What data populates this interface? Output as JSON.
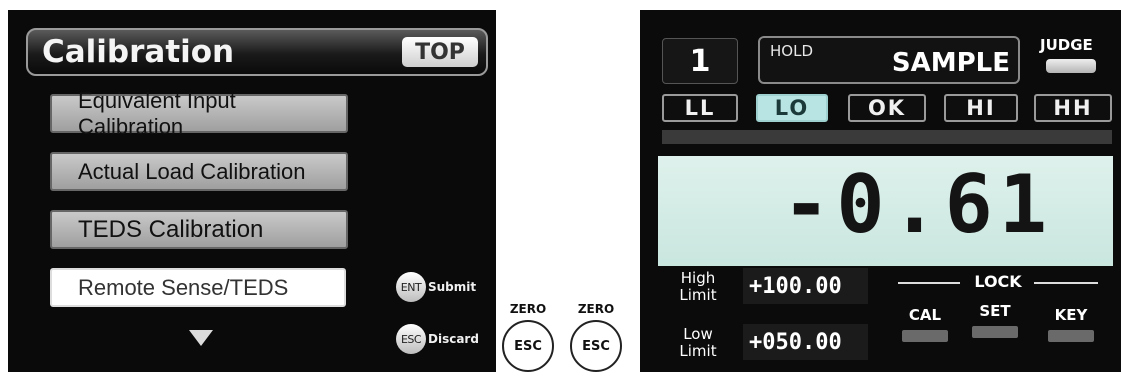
{
  "left_screen": {
    "title": "Calibration",
    "top_button": "TOP",
    "menu": [
      "Equivalent Input Calibration",
      "Actual Load Calibration",
      "TEDS Calibration",
      "Remote Sense/TEDS"
    ],
    "selected_index": 3,
    "scroll_icon": "down-arrow-icon",
    "soft_keys": [
      {
        "key": "ENT",
        "label": "Submit"
      },
      {
        "key": "ESC",
        "label": "Discard"
      }
    ]
  },
  "physical_keys": [
    {
      "top_label": "ZERO",
      "key": "ESC"
    },
    {
      "top_label": "ZERO",
      "key": "ESC"
    }
  ],
  "right_screen": {
    "channel": "1",
    "hold_label": "HOLD",
    "mode_label": "SAMPLE",
    "judge_label": "JUDGE",
    "judgments": [
      "LL",
      "LO",
      "OK",
      "HI",
      "HH"
    ],
    "active_judgment": "LO",
    "value": "-0.61",
    "high_limit": {
      "label_1": "High",
      "label_2": "Limit",
      "value": "+100.00"
    },
    "low_limit": {
      "label_1": "Low",
      "label_2": "Limit",
      "value": "+050.00"
    },
    "lock_title": "LOCK",
    "lock_keys": [
      "CAL",
      "SET",
      "KEY"
    ]
  },
  "colors": {
    "active_judgment_bg": "#b8e4e4",
    "value_panel_bg": "#d6ece6",
    "screen_bg": "#0a0a0a"
  }
}
